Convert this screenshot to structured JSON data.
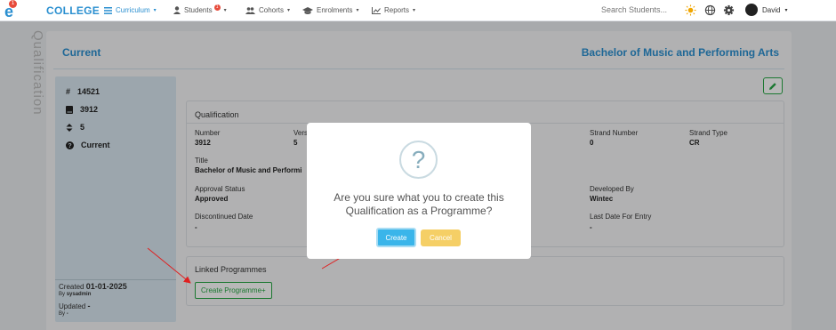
{
  "nav": {
    "brand": "COLLEGE",
    "logo_badge": "1",
    "items": [
      {
        "label": "Curriculum",
        "icon": "list-icon"
      },
      {
        "label": "Students",
        "icon": "person-icon",
        "badge": "1"
      },
      {
        "label": "Cohorts",
        "icon": "people-icon"
      },
      {
        "label": "Enrolments",
        "icon": "graduation-cap-icon"
      },
      {
        "label": "Reports",
        "icon": "line-chart-icon"
      }
    ],
    "search_placeholder": "Search Students...",
    "user_name": "David"
  },
  "page": {
    "vertical_label": "Qualification",
    "status_title": "Current",
    "qualification_name": "Bachelor of Music and Performing Arts"
  },
  "side": {
    "rows": [
      {
        "icon": "hash-icon",
        "value": "14521"
      },
      {
        "icon": "book-icon",
        "value": "3912"
      },
      {
        "icon": "sort-icon",
        "value": "5"
      },
      {
        "icon": "question-circle-icon",
        "value": "Current"
      }
    ],
    "created_label": "Created",
    "created_date": "01-01-2025",
    "created_by_label": "By",
    "created_by": "sysadmin",
    "updated_label": "Updated",
    "updated_value": "-",
    "updated_by_label": "By",
    "updated_by": "-"
  },
  "qualification": {
    "heading": "Qualification",
    "fields": {
      "number_label": "Number",
      "number_value": "3912",
      "version_label": "Vers",
      "version_value": "5",
      "strand_number_label": "Strand Number",
      "strand_number_value": "0",
      "strand_type_label": "Strand Type",
      "strand_type_value": "CR",
      "title_label": "Title",
      "title_value": "Bachelor of Music and Performi",
      "approval_label": "Approval Status",
      "approval_value": "Approved",
      "developed_label": "Developed By",
      "developed_value": "Wintec",
      "discontinued_label": "Discontinued Date",
      "discontinued_value": "-",
      "last_date_label": "Last Date For Entry",
      "last_date_value": "-"
    }
  },
  "linked": {
    "heading": "Linked Programmes",
    "create_button": "Create Programme+"
  },
  "modal": {
    "icon_glyph": "?",
    "message": "Are you sure what you to create this Qualification as a Programme?",
    "create_label": "Create",
    "cancel_label": "Cancel"
  },
  "colors": {
    "brand": "#2a8fd0",
    "create": "#3ab5ea",
    "cancel": "#f5cf66",
    "success": "#28a745",
    "annotation_arrow": "#e02020"
  }
}
